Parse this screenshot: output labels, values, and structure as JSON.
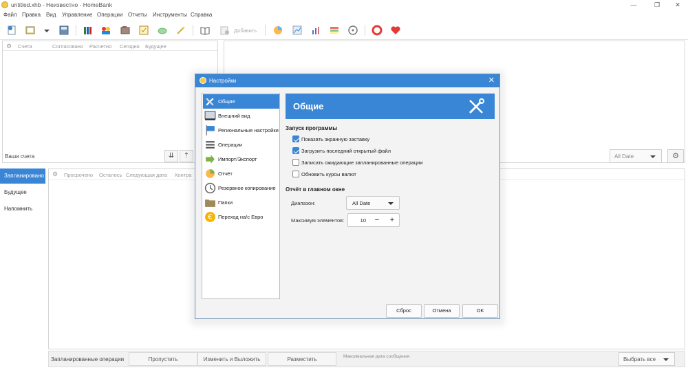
{
  "window": {
    "title": "untitled.xhb - Неизвестно - HomeBank",
    "controls": {
      "minimize": "—",
      "maximize": "❐",
      "close": "✕"
    }
  },
  "menu": [
    "Файл",
    "Правка",
    "Вид",
    "Управление",
    "Операции",
    "Отчеты",
    "Инструменты",
    "Справка"
  ],
  "toolbar": {
    "add_label": "Добавить",
    "icons": [
      "new-file-icon",
      "open-file-icon",
      "dropdown-arrow-icon",
      "save-icon",
      "accounts-icon",
      "payees-icon",
      "categories-icon",
      "scheduled-icon",
      "budget-icon",
      "assistant-icon",
      "show-transactions-icon",
      "add-transaction-icon",
      "statistics-icon",
      "trend-icon",
      "balance-icon",
      "budget-report-icon",
      "vehicle-cost-icon",
      "help-icon",
      "donate-icon"
    ]
  },
  "accounts": {
    "columns": [
      "Счета",
      "Согласовано",
      "Расчетно",
      "Сегодня",
      "Будущее"
    ],
    "footer_label": "Ваши счета"
  },
  "range": {
    "value": "All Date"
  },
  "side_tabs": [
    "Запланировано",
    "Будущее",
    "Напомнить"
  ],
  "scheduled": {
    "columns": [
      "Просрочено",
      "Осталось",
      "Следующая дата",
      "Контра"
    ],
    "footer_label": "Запланированные операции",
    "buttons": [
      "Пропустить",
      "Изменить и Выложить",
      "Разместить"
    ],
    "status": "Максимальная дата сообщения",
    "select_all": "Выбрать все"
  },
  "dialog": {
    "title": "Настройки",
    "close": "✕",
    "categories": [
      {
        "label": "Общие",
        "icon": "wrench-screwdriver-icon",
        "active": true
      },
      {
        "label": "Внешний вид",
        "icon": "display-icon",
        "active": false
      },
      {
        "label": "Региональные настройки",
        "icon": "flag-icon",
        "active": false
      },
      {
        "label": "Операции",
        "icon": "list-icon",
        "active": false
      },
      {
        "label": "Импорт/Экспорт",
        "icon": "import-export-icon",
        "active": false
      },
      {
        "label": "Отчёт",
        "icon": "report-chart-icon",
        "active": false
      },
      {
        "label": "Резервное копирование",
        "icon": "clock-icon",
        "active": false
      },
      {
        "label": "Папки",
        "icon": "folder-icon",
        "active": false
      },
      {
        "label": "Переход на/с Евро",
        "icon": "euro-coin-icon",
        "active": false
      }
    ],
    "banner_title": "Общие",
    "startup": {
      "title": "Запуск программы",
      "options": [
        {
          "label": "Показать экранную заставку",
          "checked": true
        },
        {
          "label": "Загрузить последний открытый файл",
          "checked": true
        },
        {
          "label": "Записать ожидающие запланированные операции",
          "checked": false
        },
        {
          "label": "Обновить курсы валют",
          "checked": false
        }
      ]
    },
    "main_window": {
      "title": "Отчёт в главном окне",
      "range_label": "Диапазон:",
      "range_value": "All Date",
      "max_label": "Максимум элементов:",
      "max_value": "10"
    },
    "buttons": {
      "reset": "Сброс",
      "cancel": "Отмена",
      "ok": "OK"
    }
  }
}
